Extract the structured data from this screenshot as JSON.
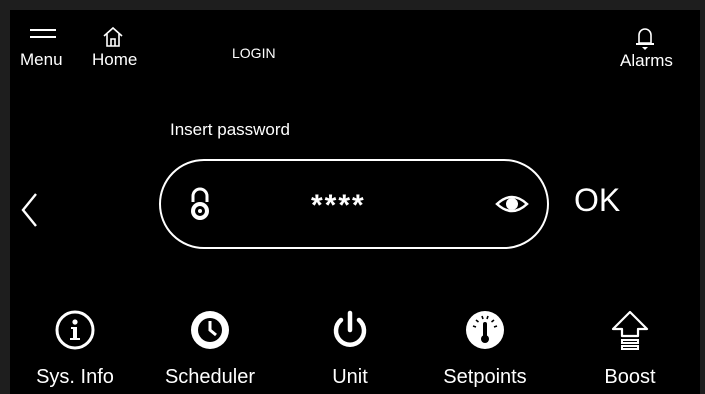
{
  "header": {
    "title": "LOGIN",
    "menu_label": "Menu",
    "home_label": "Home",
    "alarms_label": "Alarms"
  },
  "login": {
    "prompt": "Insert password",
    "password_value": "****",
    "ok_label": "OK"
  },
  "bottom_nav": {
    "sysinfo_label": "Sys. Info",
    "scheduler_label": "Scheduler",
    "unit_label": "Unit",
    "setpoints_label": "Setpoints",
    "boost_label": "Boost"
  },
  "icons": {
    "menu": "hamburger-icon",
    "home": "home-icon",
    "alarms": "bell-icon",
    "back": "chevron-left-icon",
    "lock": "lock-icon",
    "visibility": "eye-icon",
    "sysinfo": "info-icon",
    "scheduler": "clock-icon",
    "unit": "power-icon",
    "setpoints": "thermometer-gauge-icon",
    "boost": "boost-arrow-icon"
  },
  "colors": {
    "background": "#000000",
    "foreground": "#ffffff"
  }
}
